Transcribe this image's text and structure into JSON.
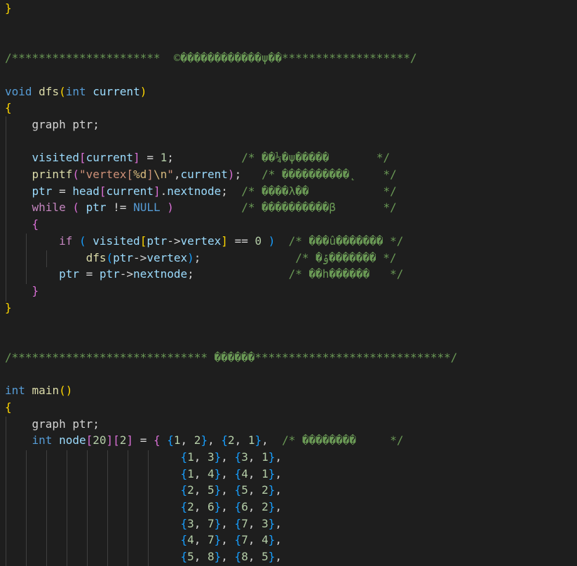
{
  "colors": {
    "background": "#1e1e1e",
    "keyword": "#569cd6",
    "control": "#c586c0",
    "function": "#dcdcaa",
    "variable": "#9cdcfe",
    "string": "#ce9178",
    "escape": "#d7ba7d",
    "number": "#b5cea8",
    "comment": "#6a9955",
    "text": "#d4d4d4",
    "bracket_1": "#ffd700",
    "bracket_2": "#da70d6",
    "bracket_3": "#179fff"
  },
  "code": {
    "lines": [
      [
        [
          "b1",
          "}"
        ]
      ],
      [],
      [],
      [
        [
          "cmt",
          "/**********************  ©������������ψ��*******************/"
        ]
      ],
      [],
      [
        [
          "kw",
          "void"
        ],
        [
          "txt",
          " "
        ],
        [
          "fn",
          "dfs"
        ],
        [
          "b1",
          "("
        ],
        [
          "kw",
          "int"
        ],
        [
          "txt",
          " "
        ],
        [
          "var",
          "current"
        ],
        [
          "b1",
          ")"
        ]
      ],
      [
        [
          "b1",
          "{"
        ]
      ],
      [
        [
          "txt",
          "    graph ptr;"
        ]
      ],
      [],
      [
        [
          "txt",
          "    "
        ],
        [
          "var",
          "visited"
        ],
        [
          "b2",
          "["
        ],
        [
          "var",
          "current"
        ],
        [
          "b2",
          "]"
        ],
        [
          "txt",
          " = "
        ],
        [
          "num",
          "1"
        ],
        [
          "txt",
          ";          "
        ],
        [
          "cmt",
          "/* ��¼�ψ�����       */"
        ]
      ],
      [
        [
          "txt",
          "    "
        ],
        [
          "fn",
          "printf"
        ],
        [
          "b2",
          "("
        ],
        [
          "str",
          "\"vertex["
        ],
        [
          "esc",
          "%d"
        ],
        [
          "str",
          "]"
        ],
        [
          "esc",
          "\\n"
        ],
        [
          "str",
          "\""
        ],
        [
          "txt",
          ","
        ],
        [
          "var",
          "current"
        ],
        [
          "b2",
          ")"
        ],
        [
          "txt",
          ";   "
        ],
        [
          "cmt",
          "/* ����������˛    */"
        ]
      ],
      [
        [
          "txt",
          "    "
        ],
        [
          "var",
          "ptr"
        ],
        [
          "txt",
          " = "
        ],
        [
          "var",
          "head"
        ],
        [
          "b2",
          "["
        ],
        [
          "var",
          "current"
        ],
        [
          "b2",
          "]"
        ],
        [
          "txt",
          "."
        ],
        [
          "var",
          "nextnode"
        ],
        [
          "txt",
          ";  "
        ],
        [
          "cmt",
          "/* ����λ��           */"
        ]
      ],
      [
        [
          "txt",
          "    "
        ],
        [
          "ctl",
          "while"
        ],
        [
          "txt",
          " "
        ],
        [
          "b2",
          "("
        ],
        [
          "txt",
          " "
        ],
        [
          "var",
          "ptr"
        ],
        [
          "txt",
          " != "
        ],
        [
          "kw",
          "NULL"
        ],
        [
          "txt",
          " "
        ],
        [
          "b2",
          ")"
        ],
        [
          "txt",
          "          "
        ],
        [
          "cmt",
          "/* ����������β       */"
        ]
      ],
      [
        [
          "txt",
          "    "
        ],
        [
          "b2",
          "{"
        ]
      ],
      [
        [
          "txt",
          "        "
        ],
        [
          "ctl",
          "if"
        ],
        [
          "txt",
          " "
        ],
        [
          "b3",
          "("
        ],
        [
          "txt",
          " "
        ],
        [
          "var",
          "visited"
        ],
        [
          "b1",
          "["
        ],
        [
          "var",
          "ptr"
        ],
        [
          "txt",
          "->"
        ],
        [
          "var",
          "vertex"
        ],
        [
          "b1",
          "]"
        ],
        [
          "txt",
          " == "
        ],
        [
          "num",
          "0"
        ],
        [
          "txt",
          " "
        ],
        [
          "b3",
          ")"
        ],
        [
          "txt",
          "  "
        ],
        [
          "cmt",
          "/* ���û������� */"
        ]
      ],
      [
        [
          "txt",
          "            "
        ],
        [
          "fn",
          "dfs"
        ],
        [
          "b3",
          "("
        ],
        [
          "var",
          "ptr"
        ],
        [
          "txt",
          "->"
        ],
        [
          "var",
          "vertex"
        ],
        [
          "b3",
          ")"
        ],
        [
          "txt",
          ";              "
        ],
        [
          "cmt",
          "/* �ݹ������� */"
        ]
      ],
      [
        [
          "txt",
          "        "
        ],
        [
          "var",
          "ptr"
        ],
        [
          "txt",
          " = "
        ],
        [
          "var",
          "ptr"
        ],
        [
          "txt",
          "->"
        ],
        [
          "var",
          "nextnode"
        ],
        [
          "txt",
          ";              "
        ],
        [
          "cmt",
          "/* ��һ������   */"
        ]
      ],
      [
        [
          "txt",
          "    "
        ],
        [
          "b2",
          "}"
        ]
      ],
      [
        [
          "b1",
          "}"
        ]
      ],
      [],
      [],
      [
        [
          "cmt",
          "/***************************** ������*****************************/"
        ]
      ],
      [],
      [
        [
          "kw",
          "int"
        ],
        [
          "txt",
          " "
        ],
        [
          "fn",
          "main"
        ],
        [
          "b1",
          "()"
        ]
      ],
      [
        [
          "b1",
          "{"
        ]
      ],
      [
        [
          "txt",
          "    graph ptr;"
        ]
      ],
      [
        [
          "txt",
          "    "
        ],
        [
          "kw",
          "int"
        ],
        [
          "txt",
          " "
        ],
        [
          "var",
          "node"
        ],
        [
          "b2",
          "["
        ],
        [
          "num",
          "20"
        ],
        [
          "b2",
          "]["
        ],
        [
          "num",
          "2"
        ],
        [
          "b2",
          "]"
        ],
        [
          "txt",
          " = "
        ],
        [
          "b2",
          "{"
        ],
        [
          "txt",
          " "
        ],
        [
          "b3",
          "{"
        ],
        [
          "num",
          "1"
        ],
        [
          "txt",
          ", "
        ],
        [
          "num",
          "2"
        ],
        [
          "b3",
          "}"
        ],
        [
          "txt",
          ", "
        ],
        [
          "b3",
          "{"
        ],
        [
          "num",
          "2"
        ],
        [
          "txt",
          ", "
        ],
        [
          "num",
          "1"
        ],
        [
          "b3",
          "}"
        ],
        [
          "txt",
          ",  "
        ],
        [
          "cmt",
          "/* ��������     */"
        ]
      ],
      [
        [
          "txt",
          "                          "
        ],
        [
          "b3",
          "{"
        ],
        [
          "num",
          "1"
        ],
        [
          "txt",
          ", "
        ],
        [
          "num",
          "3"
        ],
        [
          "b3",
          "}"
        ],
        [
          "txt",
          ", "
        ],
        [
          "b3",
          "{"
        ],
        [
          "num",
          "3"
        ],
        [
          "txt",
          ", "
        ],
        [
          "num",
          "1"
        ],
        [
          "b3",
          "}"
        ],
        [
          "txt",
          ","
        ]
      ],
      [
        [
          "txt",
          "                          "
        ],
        [
          "b3",
          "{"
        ],
        [
          "num",
          "1"
        ],
        [
          "txt",
          ", "
        ],
        [
          "num",
          "4"
        ],
        [
          "b3",
          "}"
        ],
        [
          "txt",
          ", "
        ],
        [
          "b3",
          "{"
        ],
        [
          "num",
          "4"
        ],
        [
          "txt",
          ", "
        ],
        [
          "num",
          "1"
        ],
        [
          "b3",
          "}"
        ],
        [
          "txt",
          ","
        ]
      ],
      [
        [
          "txt",
          "                          "
        ],
        [
          "b3",
          "{"
        ],
        [
          "num",
          "2"
        ],
        [
          "txt",
          ", "
        ],
        [
          "num",
          "5"
        ],
        [
          "b3",
          "}"
        ],
        [
          "txt",
          ", "
        ],
        [
          "b3",
          "{"
        ],
        [
          "num",
          "5"
        ],
        [
          "txt",
          ", "
        ],
        [
          "num",
          "2"
        ],
        [
          "b3",
          "}"
        ],
        [
          "txt",
          ","
        ]
      ],
      [
        [
          "txt",
          "                          "
        ],
        [
          "b3",
          "{"
        ],
        [
          "num",
          "2"
        ],
        [
          "txt",
          ", "
        ],
        [
          "num",
          "6"
        ],
        [
          "b3",
          "}"
        ],
        [
          "txt",
          ", "
        ],
        [
          "b3",
          "{"
        ],
        [
          "num",
          "6"
        ],
        [
          "txt",
          ", "
        ],
        [
          "num",
          "2"
        ],
        [
          "b3",
          "}"
        ],
        [
          "txt",
          ","
        ]
      ],
      [
        [
          "txt",
          "                          "
        ],
        [
          "b3",
          "{"
        ],
        [
          "num",
          "3"
        ],
        [
          "txt",
          ", "
        ],
        [
          "num",
          "7"
        ],
        [
          "b3",
          "}"
        ],
        [
          "txt",
          ", "
        ],
        [
          "b3",
          "{"
        ],
        [
          "num",
          "7"
        ],
        [
          "txt",
          ", "
        ],
        [
          "num",
          "3"
        ],
        [
          "b3",
          "}"
        ],
        [
          "txt",
          ","
        ]
      ],
      [
        [
          "txt",
          "                          "
        ],
        [
          "b3",
          "{"
        ],
        [
          "num",
          "4"
        ],
        [
          "txt",
          ", "
        ],
        [
          "num",
          "7"
        ],
        [
          "b3",
          "}"
        ],
        [
          "txt",
          ", "
        ],
        [
          "b3",
          "{"
        ],
        [
          "num",
          "7"
        ],
        [
          "txt",
          ", "
        ],
        [
          "num",
          "4"
        ],
        [
          "b3",
          "}"
        ],
        [
          "txt",
          ","
        ]
      ],
      [
        [
          "txt",
          "                          "
        ],
        [
          "b3",
          "{"
        ],
        [
          "num",
          "5"
        ],
        [
          "txt",
          ", "
        ],
        [
          "num",
          "8"
        ],
        [
          "b3",
          "}"
        ],
        [
          "txt",
          ", "
        ],
        [
          "b3",
          "{"
        ],
        [
          "num",
          "8"
        ],
        [
          "txt",
          ", "
        ],
        [
          "num",
          "5"
        ],
        [
          "b3",
          "}"
        ],
        [
          "txt",
          ","
        ]
      ]
    ]
  }
}
